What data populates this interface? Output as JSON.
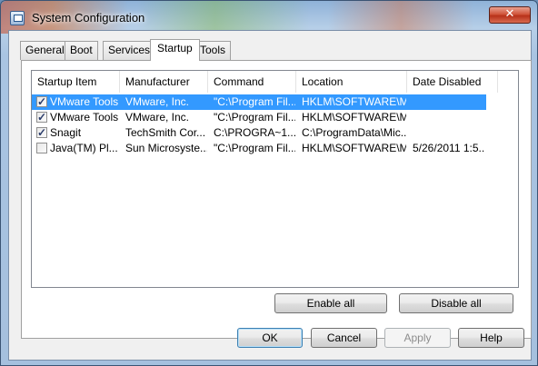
{
  "window": {
    "title": "System Configuration",
    "close_glyph": "✕"
  },
  "tabs": [
    "General",
    "Boot",
    "Services",
    "Startup",
    "Tools"
  ],
  "active_tab": "Startup",
  "columns": [
    "Startup Item",
    "Manufacturer",
    "Command",
    "Location",
    "Date Disabled"
  ],
  "rows": [
    {
      "checked": true,
      "item": "VMware Tools",
      "manufacturer": "VMware, Inc.",
      "command": "\"C:\\Program Fil...",
      "location": "HKLM\\SOFTWARE\\M...",
      "date_disabled": ""
    },
    {
      "checked": true,
      "item": "VMware Tools",
      "manufacturer": "VMware, Inc.",
      "command": "\"C:\\Program Fil...",
      "location": "HKLM\\SOFTWARE\\M...",
      "date_disabled": ""
    },
    {
      "checked": true,
      "item": "Snagit",
      "manufacturer": "TechSmith Cor...",
      "command": "C:\\PROGRA~1...",
      "location": "C:\\ProgramData\\Mic...",
      "date_disabled": ""
    },
    {
      "checked": false,
      "item": "Java(TM) Pl...",
      "manufacturer": "Sun Microsyste...",
      "command": "\"C:\\Program Fil...",
      "location": "HKLM\\SOFTWARE\\M...",
      "date_disabled": "5/26/2011 1:5..."
    }
  ],
  "selected_row": 0,
  "buttons": {
    "enable_all": "Enable all",
    "disable_all": "Disable all",
    "ok": "OK",
    "cancel": "Cancel",
    "apply": "Apply",
    "help": "Help"
  },
  "icons": {
    "window": "system-config-icon",
    "checkbox": "checkmark-icon"
  },
  "colors": {
    "selection": "#3399ff",
    "close_button": "#c8442a"
  }
}
